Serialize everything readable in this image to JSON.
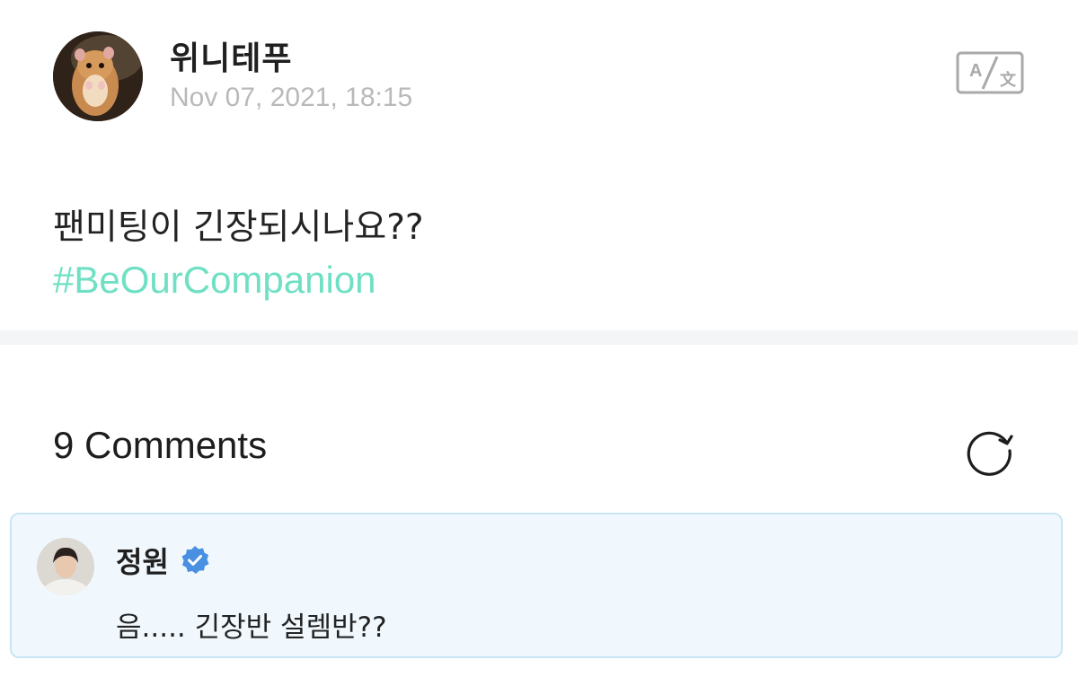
{
  "post": {
    "author": "위니테푸",
    "timestamp": "Nov 07, 2021, 18:15",
    "avatar_icon": "hamster-avatar",
    "translate_icon": "translate-icon",
    "body": "팬미팅이 긴장되시나요??",
    "hashtag": "#BeOurCompanion"
  },
  "comments": {
    "header": "9 Comments",
    "refresh_icon": "refresh-icon",
    "items": [
      {
        "author": "정원",
        "verified": true,
        "text": "음..... 긴장반 설렘반??"
      }
    ]
  },
  "colors": {
    "hashtag": "#6fe0c3",
    "timestamp": "#b9b9b9",
    "verified_badge": "#4a90e2",
    "comment_bg": "#f0f8fd",
    "comment_border": "#c9e5f5",
    "divider": "#f4f5f7"
  }
}
